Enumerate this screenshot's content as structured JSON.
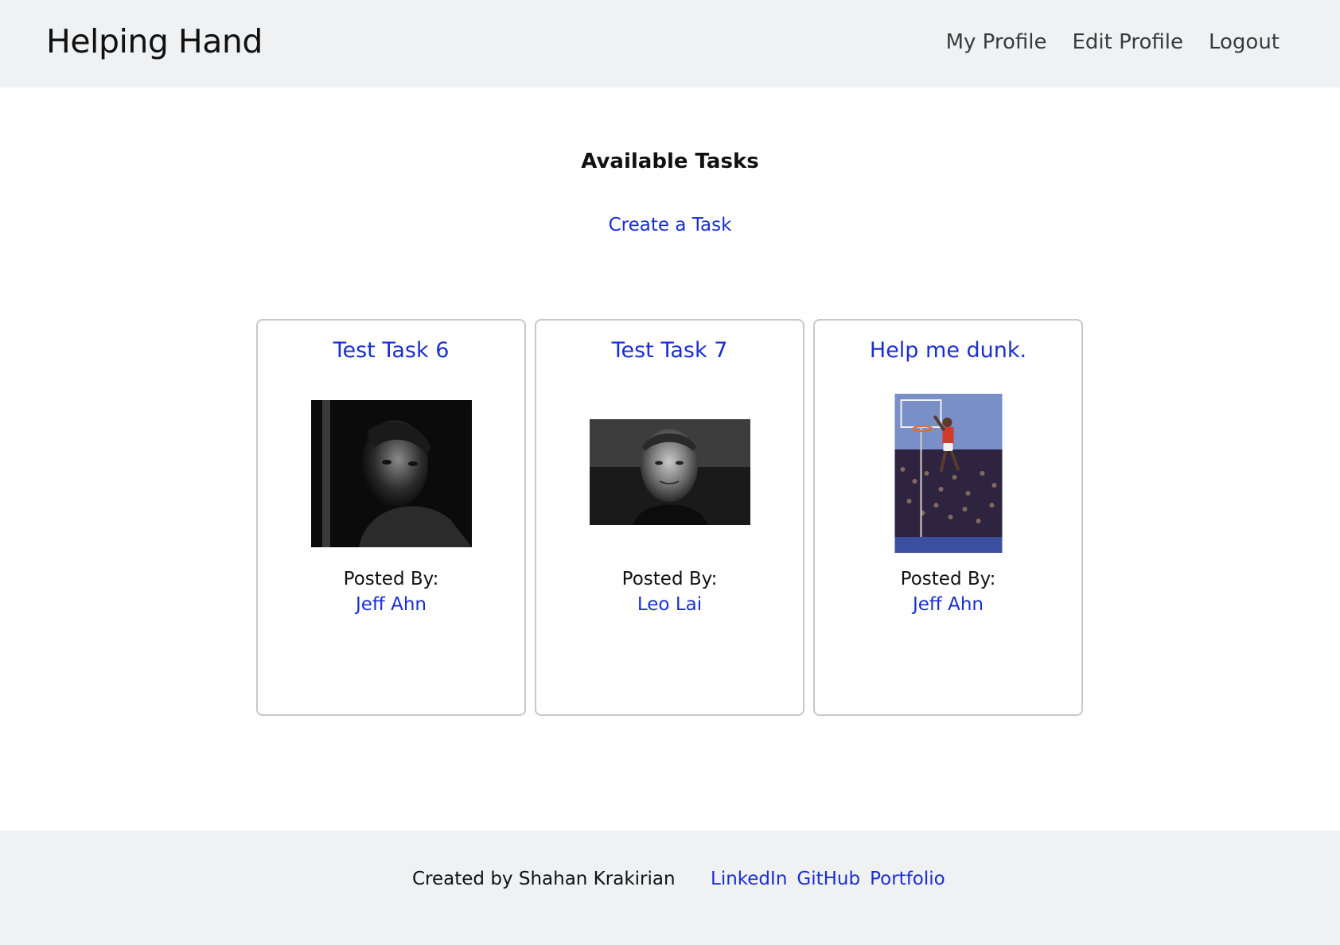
{
  "header": {
    "brand": "Helping Hand",
    "nav": [
      {
        "label": "My Profile"
      },
      {
        "label": "Edit Profile"
      },
      {
        "label": "Logout"
      }
    ]
  },
  "main": {
    "heading": "Available Tasks",
    "create_link": "Create a Task"
  },
  "tasks": [
    {
      "title": "Test Task 6",
      "image": "portrait-photo",
      "posted_label": "Posted By:",
      "poster": "Jeff Ahn"
    },
    {
      "title": "Test Task 7",
      "image": "portrait-photo",
      "posted_label": "Posted By:",
      "poster": "Leo Lai"
    },
    {
      "title": "Help me dunk.",
      "image": "basketball-dunk-photo",
      "posted_label": "Posted By:",
      "poster": "Jeff Ahn"
    }
  ],
  "footer": {
    "credit": "Created by Shahan Krakirian",
    "links": [
      {
        "label": "LinkedIn"
      },
      {
        "label": "GitHub"
      },
      {
        "label": "Portfolio"
      }
    ]
  },
  "colors": {
    "link": "#1a2fd0",
    "header_bg": "#f0f1f2",
    "card_border": "#c8c8c8"
  }
}
